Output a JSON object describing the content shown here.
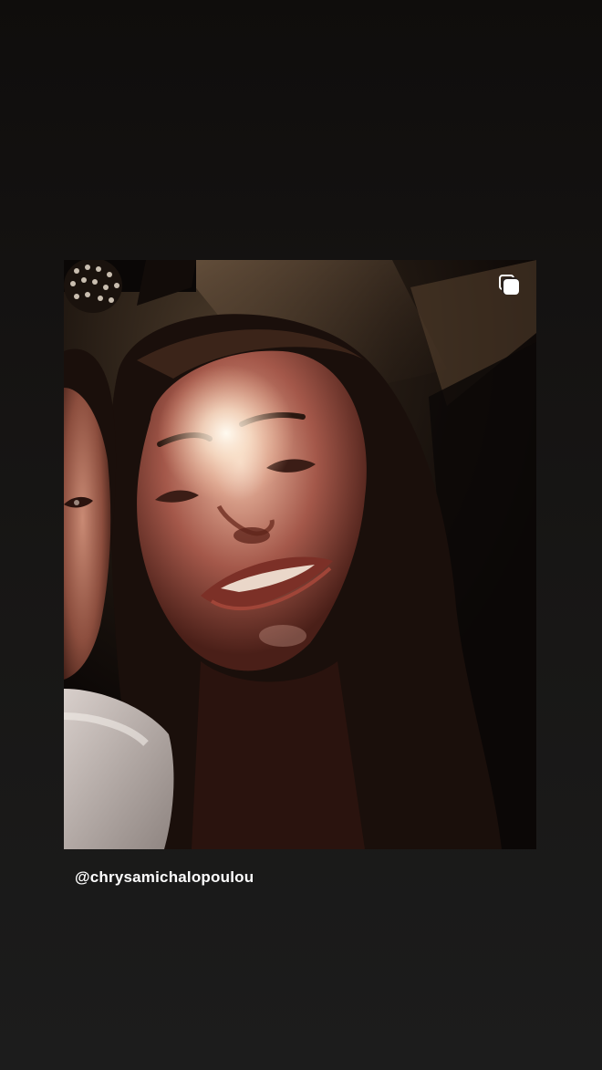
{
  "story": {
    "post": {
      "multiple_media_indicator": "multiple-photos-icon",
      "image_alt": "Close-up selfie of two people in dim light"
    },
    "mention": "@chrysamichalopoulou"
  }
}
